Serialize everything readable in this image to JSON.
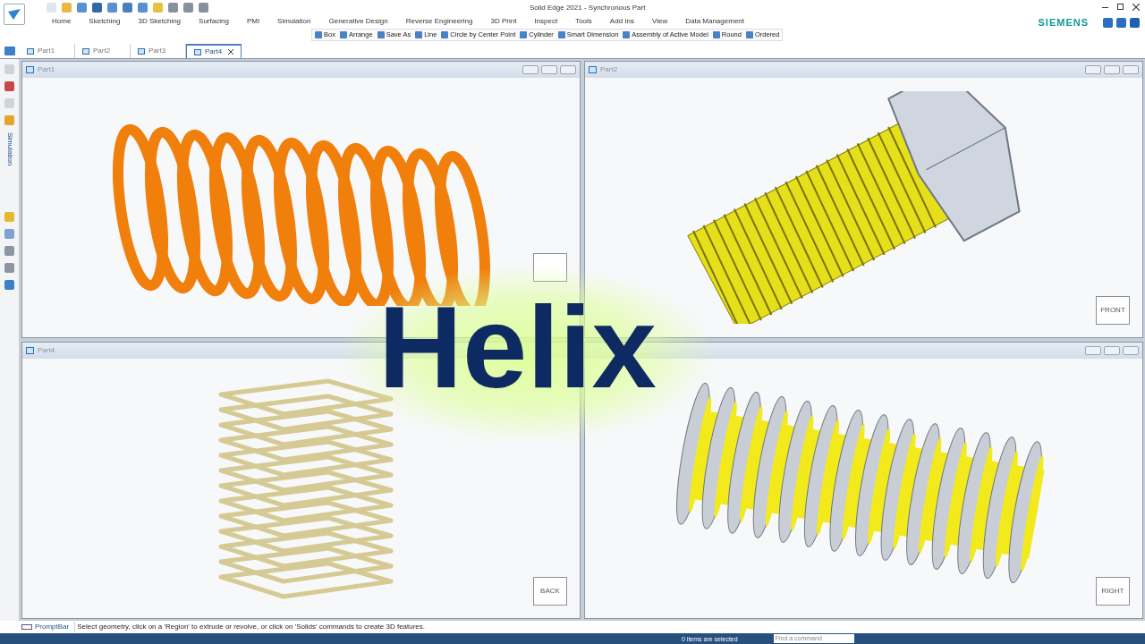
{
  "window": {
    "title": "Solid Edge 2021 - Synchronous Part",
    "brand": "SIEMENS"
  },
  "ribbon_tabs": [
    "Home",
    "Sketching",
    "3D Sketching",
    "Surfacing",
    "PMI",
    "Simulation",
    "Generative Design",
    "Reverse Engineering",
    "3D Print",
    "Inspect",
    "Tools",
    "Add Ins",
    "View",
    "Data Management"
  ],
  "commands": [
    "Box",
    "Arrange",
    "Save As",
    "Line",
    "Circle by Center Point",
    "Cylinder",
    "Smart Dimension",
    "Assembly of Active Model",
    "Round",
    "Ordered"
  ],
  "document_tabs": [
    {
      "label": "Part1",
      "selected": false
    },
    {
      "label": "Part2",
      "selected": false
    },
    {
      "label": "Part3",
      "selected": false
    },
    {
      "label": "Part4",
      "selected": true
    }
  ],
  "side_panel": {
    "label": "Simulation"
  },
  "viewports": [
    {
      "title": "Part1",
      "kind": "spring",
      "window_buttons": true
    },
    {
      "title": "Part2",
      "kind": "bolt",
      "cube_label": "FRONT",
      "window_buttons": true
    },
    {
      "title": "Part4",
      "kind": "square_coil",
      "cube_label": "BACK",
      "window_buttons": false
    },
    {
      "kind": "threaded_rod",
      "cube_label": "RIGHT",
      "window_buttons": true
    }
  ],
  "overlay_title": "Helix",
  "prompt_bar": {
    "label": "PromptBar",
    "message": "Select geometry, click on a 'Region' to extrude or revolve, or click on 'Solids' commands to create 3D features."
  },
  "status_bar": {
    "selection": "0 items are selected",
    "search_placeholder": "Find a command"
  }
}
